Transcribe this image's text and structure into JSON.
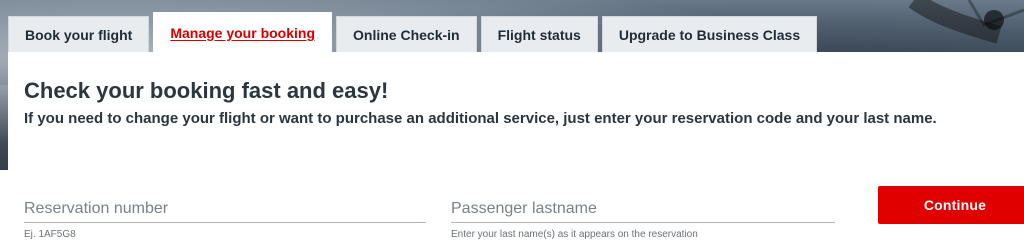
{
  "tabs": {
    "items": [
      {
        "label": "Book your flight",
        "active": false
      },
      {
        "label": "Manage your booking",
        "active": true
      },
      {
        "label": "Online Check-in",
        "active": false
      },
      {
        "label": "Flight status",
        "active": false
      },
      {
        "label": "Upgrade to Business Class",
        "active": false
      }
    ]
  },
  "panel": {
    "title": "Check your booking fast and easy!",
    "subtitle": "If you need to change your flight or want to purchase an additional service, just enter your reservation code and your last name."
  },
  "form": {
    "reservation": {
      "label": "Reservation number",
      "value": "",
      "hint": "Ej. 1AF5G8"
    },
    "lastname": {
      "label": "Passenger lastname",
      "value": "",
      "hint": "Enter your last name(s) as it appears on the reservation"
    },
    "continue_label": "Continue"
  },
  "colors": {
    "accent": "#e00000",
    "active_tab_text": "#d40000",
    "tab_bg": "#e9ecef",
    "text_primary": "#2a3640"
  },
  "icons": {
    "hero": "windsurfer-photo"
  }
}
